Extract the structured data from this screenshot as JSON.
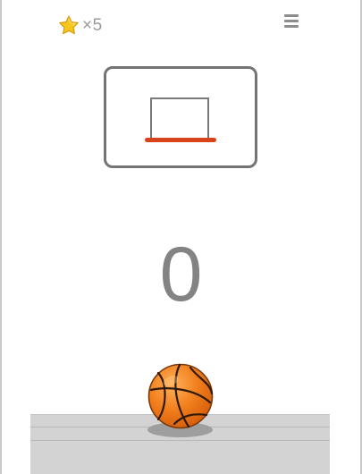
{
  "hud": {
    "stars_text": "×5",
    "star_icon": "star-icon",
    "menu_icon": "menu-icon"
  },
  "game": {
    "score": "0",
    "ball_icon": "basketball-icon"
  },
  "colors": {
    "rim": "#d7441b",
    "ball": "#f07c1a",
    "star": "#f6c61b",
    "court": "#d3d3d3"
  }
}
